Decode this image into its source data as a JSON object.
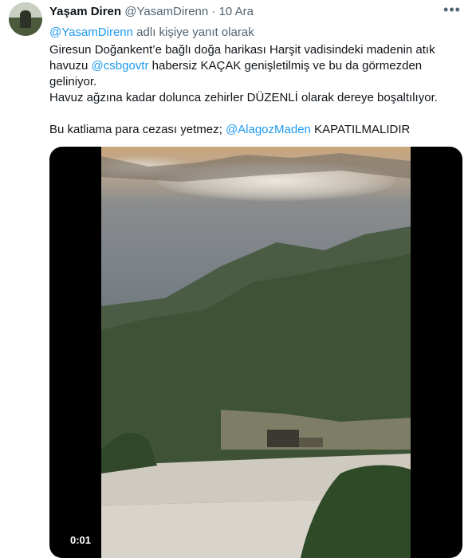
{
  "tweet": {
    "author_name": "Yaşam Diren",
    "author_handle": "@YasamDirenn",
    "separator": "·",
    "date": "10 Ara",
    "more_icon": "more-dots-icon",
    "reply_to_handle": "@YasamDirenn",
    "reply_to_suffix": "adlı kişiye yanıt olarak",
    "line1_a": "Giresun Doğankent’e bağlı doğa harikası Harşit vadisindeki madenin atık havuzu ",
    "line1_mention": "@csbgovtr",
    "line1_b": " habersiz KAÇAK genişletilmiş ve bu da görmezden geliniyor.",
    "line2": "Havuz ağzına kadar dolunca zehirler DÜZENLİ olarak dereye boşaltılıyor.",
    "line3_a": "Bu katliama para cezası yetmez; ",
    "line3_mention": "@AlagozMaden",
    "line3_b": " KAPATILMALIDIR"
  },
  "media": {
    "timestamp": "0:01"
  }
}
